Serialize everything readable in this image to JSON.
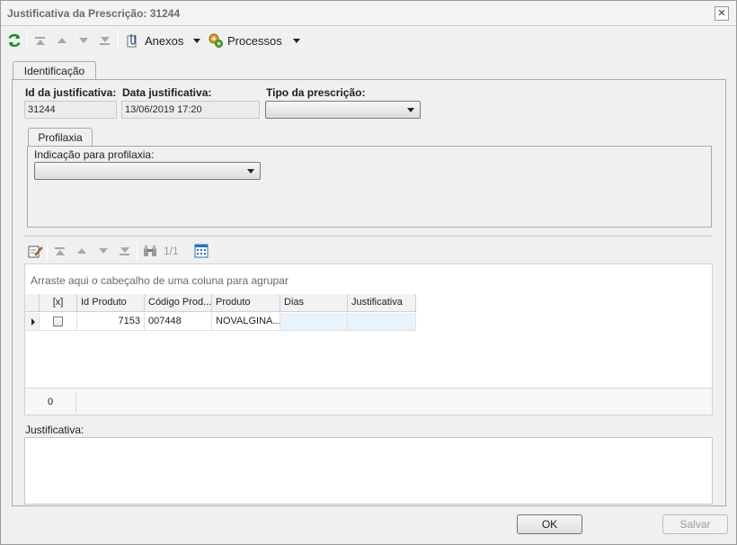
{
  "window": {
    "title": "Justificativa da Prescrição: 31244",
    "close_glyph": "✕"
  },
  "toolbar": {
    "refresh_icon": "refresh-icon",
    "nav_icons": [
      "first-record-icon",
      "prev-record-icon",
      "next-record-icon",
      "last-record-icon"
    ],
    "anexos_label": "Anexos",
    "processos_label": "Processos"
  },
  "tabs": {
    "main": "Identificação",
    "sub": "Profilaxia"
  },
  "fields": {
    "id_label": "Id da justificativa:",
    "id_value": "31244",
    "date_label": "Data justificativa:",
    "date_value": "13/06/2019 17:20",
    "tipo_label": "Tipo da prescrição:",
    "tipo_value": "",
    "profilaxia_label": "Indicação para profilaxia:",
    "profilaxia_value": ""
  },
  "grid_toolbar": {
    "page_indicator": "1/1"
  },
  "grid": {
    "group_hint": "Arraste aqui o cabeçalho de uma coluna para agrupar",
    "columns": [
      "",
      "[x]",
      "Id Produto",
      "Código Prod...",
      "Produto",
      "Dias",
      "Justificativa"
    ],
    "rows": [
      {
        "checked": false,
        "id_produto": "7153",
        "codigo": "007448",
        "produto": "NOVALGINA...",
        "dias": "",
        "justificativa": ""
      }
    ],
    "footer_count": "0"
  },
  "justificativa": {
    "label": "Justificativa:",
    "value": ""
  },
  "buttons": {
    "ok": "OK",
    "salvar": "Salvar"
  }
}
